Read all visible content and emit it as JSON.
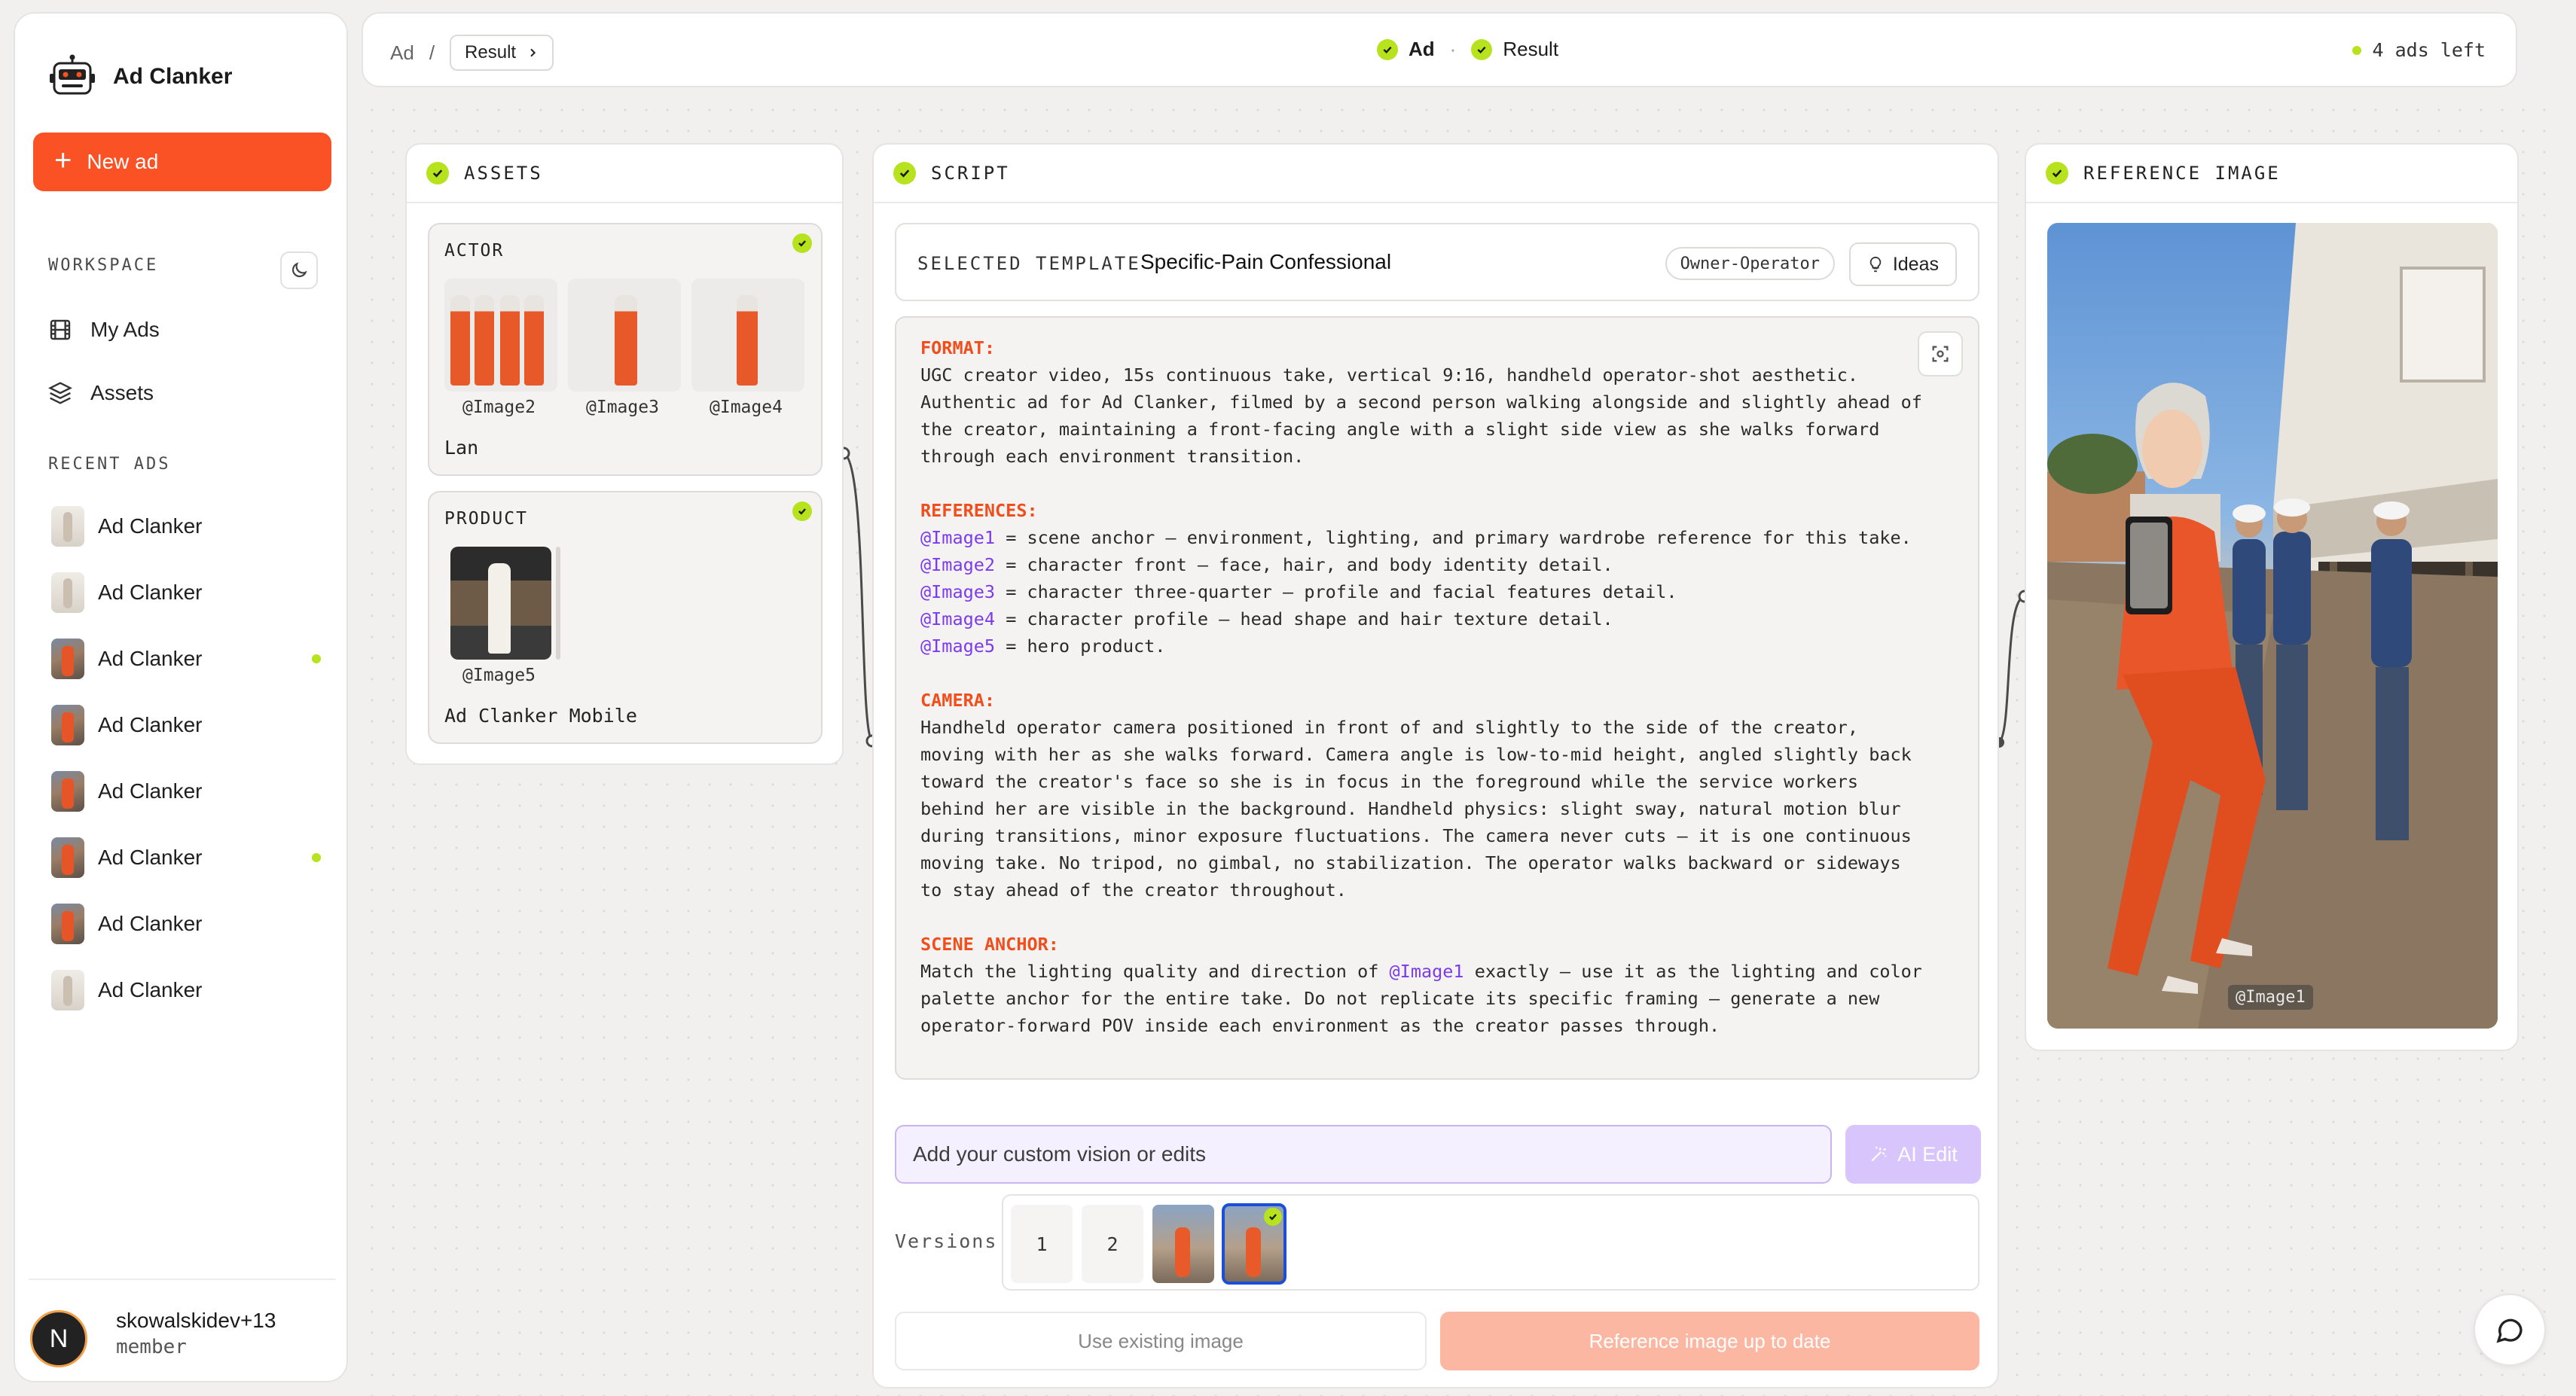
{
  "app": {
    "name": "Ad Clanker"
  },
  "sidebar": {
    "new_ad_label": "New ad",
    "workspace_label": "WORKSPACE",
    "nav": [
      {
        "label": "My Ads",
        "icon": "film-icon"
      },
      {
        "label": "Assets",
        "icon": "layers-icon"
      }
    ],
    "recent_label": "RECENT ADS",
    "recent": [
      {
        "label": "Ad Clanker",
        "thumb": "light",
        "status_dot": false
      },
      {
        "label": "Ad Clanker",
        "thumb": "light",
        "status_dot": false
      },
      {
        "label": "Ad Clanker",
        "thumb": "dark",
        "status_dot": true
      },
      {
        "label": "Ad Clanker",
        "thumb": "dark",
        "status_dot": false
      },
      {
        "label": "Ad Clanker",
        "thumb": "dark",
        "status_dot": false
      },
      {
        "label": "Ad Clanker",
        "thumb": "dark",
        "status_dot": true
      },
      {
        "label": "Ad Clanker",
        "thumb": "dark",
        "status_dot": false
      },
      {
        "label": "Ad Clanker",
        "thumb": "light",
        "status_dot": false
      }
    ],
    "user": {
      "initial": "N",
      "name": "skowalskidev+13",
      "role": "member"
    }
  },
  "topbar": {
    "crumb_root": "Ad",
    "crumb_sep": "/",
    "crumb_current": "Result",
    "steps": [
      "Ad",
      "Result"
    ],
    "step_sep": "·",
    "ads_left": "4 ads left"
  },
  "assets": {
    "title": "ASSETS",
    "actor": {
      "title": "ACTOR",
      "images": [
        "@Image2",
        "@Image3",
        "@Image4"
      ],
      "name": "Lan"
    },
    "product": {
      "title": "PRODUCT",
      "images": [
        "@Image5"
      ],
      "name": "Ad Clanker Mobile"
    }
  },
  "script": {
    "title": "SCRIPT",
    "template_label": "SELECTED TEMPLATE",
    "template_name": "Specific-Pain Confessional",
    "template_tag": "Owner-Operator",
    "ideas_label": "Ideas",
    "format_heading": "FORMAT:",
    "format_text": "UGC creator video, 15s continuous take, vertical 9:16, handheld operator-shot aesthetic.\nAuthentic ad for Ad Clanker, filmed by a second person walking alongside and slightly ahead of\nthe creator, maintaining a front-facing angle with a slight side view as she walks forward\nthrough each environment transition.",
    "references_heading": "REFERENCES:",
    "references": [
      {
        "tag": "@Image1",
        "text": " = scene anchor — environment, lighting, and primary wardrobe reference for this take."
      },
      {
        "tag": "@Image2",
        "text": " = character front — face, hair, and body identity detail."
      },
      {
        "tag": "@Image3",
        "text": " = character three-quarter — profile and facial features detail."
      },
      {
        "tag": "@Image4",
        "text": " = character profile — head shape and hair texture detail."
      },
      {
        "tag": "@Image5",
        "text": " = hero product."
      }
    ],
    "camera_heading": "CAMERA:",
    "camera_text": "Handheld operator camera positioned in front of and slightly to the side of the creator,\nmoving with her as she walks forward. Camera angle is low-to-mid height, angled slightly back\ntoward the creator's face so she is in focus in the foreground while the service workers\nbehind her are visible in the background. Handheld physics: slight sway, natural motion blur\nduring transitions, minor exposure fluctuations. The camera never cuts — it is one continuous\nmoving take. No tripod, no gimbal, no stabilization. The operator walks backward or sideways\nto stay ahead of the creator throughout.",
    "anchor_heading": "SCENE ANCHOR:",
    "anchor_pre": "Match the lighting quality and direction of ",
    "anchor_tag": "@Image1",
    "anchor_post": " exactly — use it as the lighting and color\npalette anchor for the entire take. Do not replicate its specific framing — generate a new\noperator-forward POV inside each environment as the creator passes through.",
    "edit_placeholder": "Add your custom vision or edits",
    "ai_edit_label": "AI Edit",
    "versions_label": "Versions",
    "versions": [
      "1",
      "2"
    ],
    "use_existing_label": "Use existing image",
    "up_to_date_label": "Reference image up to date"
  },
  "reference": {
    "title": "REFERENCE IMAGE",
    "badge": "@Image1"
  },
  "colors": {
    "accent": "#fa5224",
    "check": "#b6e31d",
    "ref_tag": "#7c3aed",
    "section": "#f04e1c"
  }
}
